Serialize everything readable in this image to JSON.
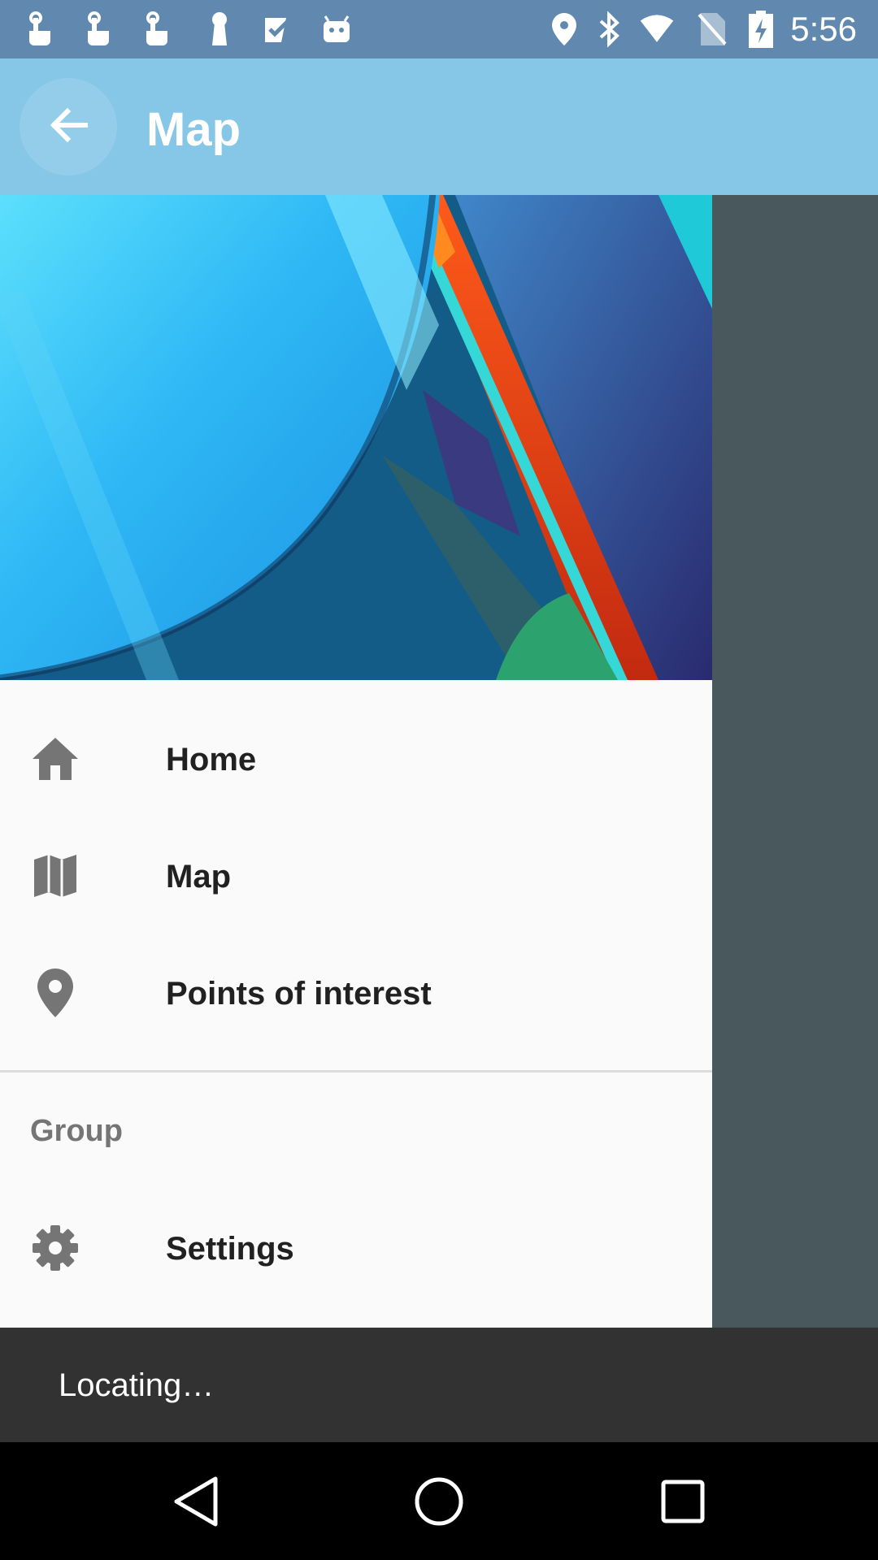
{
  "status_bar": {
    "time": "5:56",
    "left_icons": [
      "touch-app-icon",
      "touch-app-icon",
      "touch-app-icon",
      "keyhole-icon",
      "check-icon",
      "android-icon"
    ],
    "right_icons": [
      "location-icon",
      "bluetooth-icon",
      "wifi-icon",
      "no-sim-icon",
      "battery-charging-icon"
    ]
  },
  "app_bar": {
    "title": "Map",
    "back_icon": "arrow-back-icon"
  },
  "drawer": {
    "items": [
      {
        "label": "Home",
        "icon": "home-icon"
      },
      {
        "label": "Map",
        "icon": "map-icon"
      },
      {
        "label": "Points of interest",
        "icon": "place-icon"
      }
    ],
    "group_label": "Group",
    "group_items": [
      {
        "label": "Settings",
        "icon": "settings-icon"
      }
    ]
  },
  "snackbar": {
    "message": "Locating…"
  },
  "nav_bar": {
    "buttons": [
      "back-triangle-icon",
      "home-circle-icon",
      "recents-square-icon"
    ]
  },
  "colors": {
    "status_bar": "#6189b0",
    "app_bar": "#86c6e6",
    "scrim": "#48585c",
    "drawer_bg": "#fafafa",
    "snackbar": "#323232"
  }
}
